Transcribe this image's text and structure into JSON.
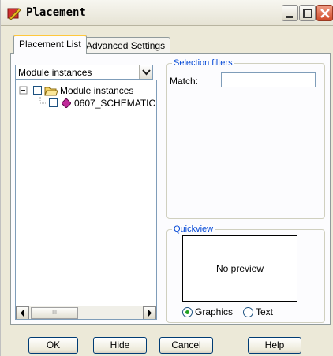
{
  "window": {
    "title": "Placement",
    "minimize_icon": "minimize-icon",
    "maximize_icon": "maximize-icon",
    "close_icon": "close-icon"
  },
  "tabs": [
    {
      "label": "Placement List",
      "active": true
    },
    {
      "label": "Advanced Settings",
      "active": false
    }
  ],
  "list_type": {
    "selected": "Module instances"
  },
  "tree": {
    "root": {
      "label": "Module instances",
      "icon": "folder-open-icon",
      "expander": "⊟"
    },
    "children": [
      {
        "label": "0607_SCHEMATIC",
        "icon": "module-icon"
      }
    ],
    "scroll_thumb": "III"
  },
  "selection_filters": {
    "legend": "Selection filters",
    "match_label": "Match:",
    "match_value": ""
  },
  "quickview": {
    "legend": "Quickview",
    "preview_text": "No preview",
    "options": [
      {
        "label": "Graphics",
        "checked": true
      },
      {
        "label": "Text",
        "checked": false
      }
    ]
  },
  "buttons": {
    "ok": "OK",
    "hide": "Hide",
    "cancel": "Cancel",
    "help": "Help"
  },
  "colors": {
    "accent_legend": "#0046d5",
    "tab_highlight": "#ffc83c",
    "close_button": "#d04a28"
  }
}
